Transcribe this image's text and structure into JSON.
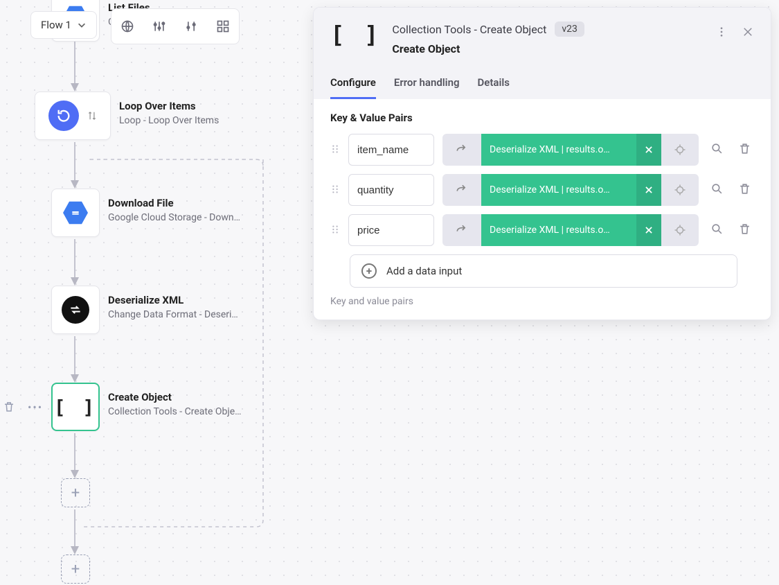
{
  "toolbar": {
    "flow_name": "Flow 1"
  },
  "nodes": {
    "list_files": {
      "title": "List Files",
      "sub": "G…"
    },
    "loop": {
      "title": "Loop Over Items",
      "sub": "Loop - Loop Over Items"
    },
    "download": {
      "title": "Download File",
      "sub": "Google Cloud Storage - Down…"
    },
    "deser": {
      "title": "Deserialize XML",
      "sub": "Change Data Format - Deseri…"
    },
    "create": {
      "title": "Create Object",
      "sub": "Collection Tools - Create Obje…"
    }
  },
  "panel": {
    "module_path": "Collection Tools - Create Object",
    "version": "v23",
    "node_name": "Create Object",
    "tabs": {
      "configure": "Configure",
      "error": "Error handling",
      "details": "Details"
    },
    "section_label": "Key & Value Pairs",
    "rows": [
      {
        "key": "item_name",
        "value_label": "Deserialize XML | results.o…"
      },
      {
        "key": "quantity",
        "value_label": "Deserialize XML | results.o…"
      },
      {
        "key": "price",
        "value_label": "Deserialize XML | results.o…"
      }
    ],
    "add_label": "Add a data input",
    "hint": "Key and value pairs"
  }
}
